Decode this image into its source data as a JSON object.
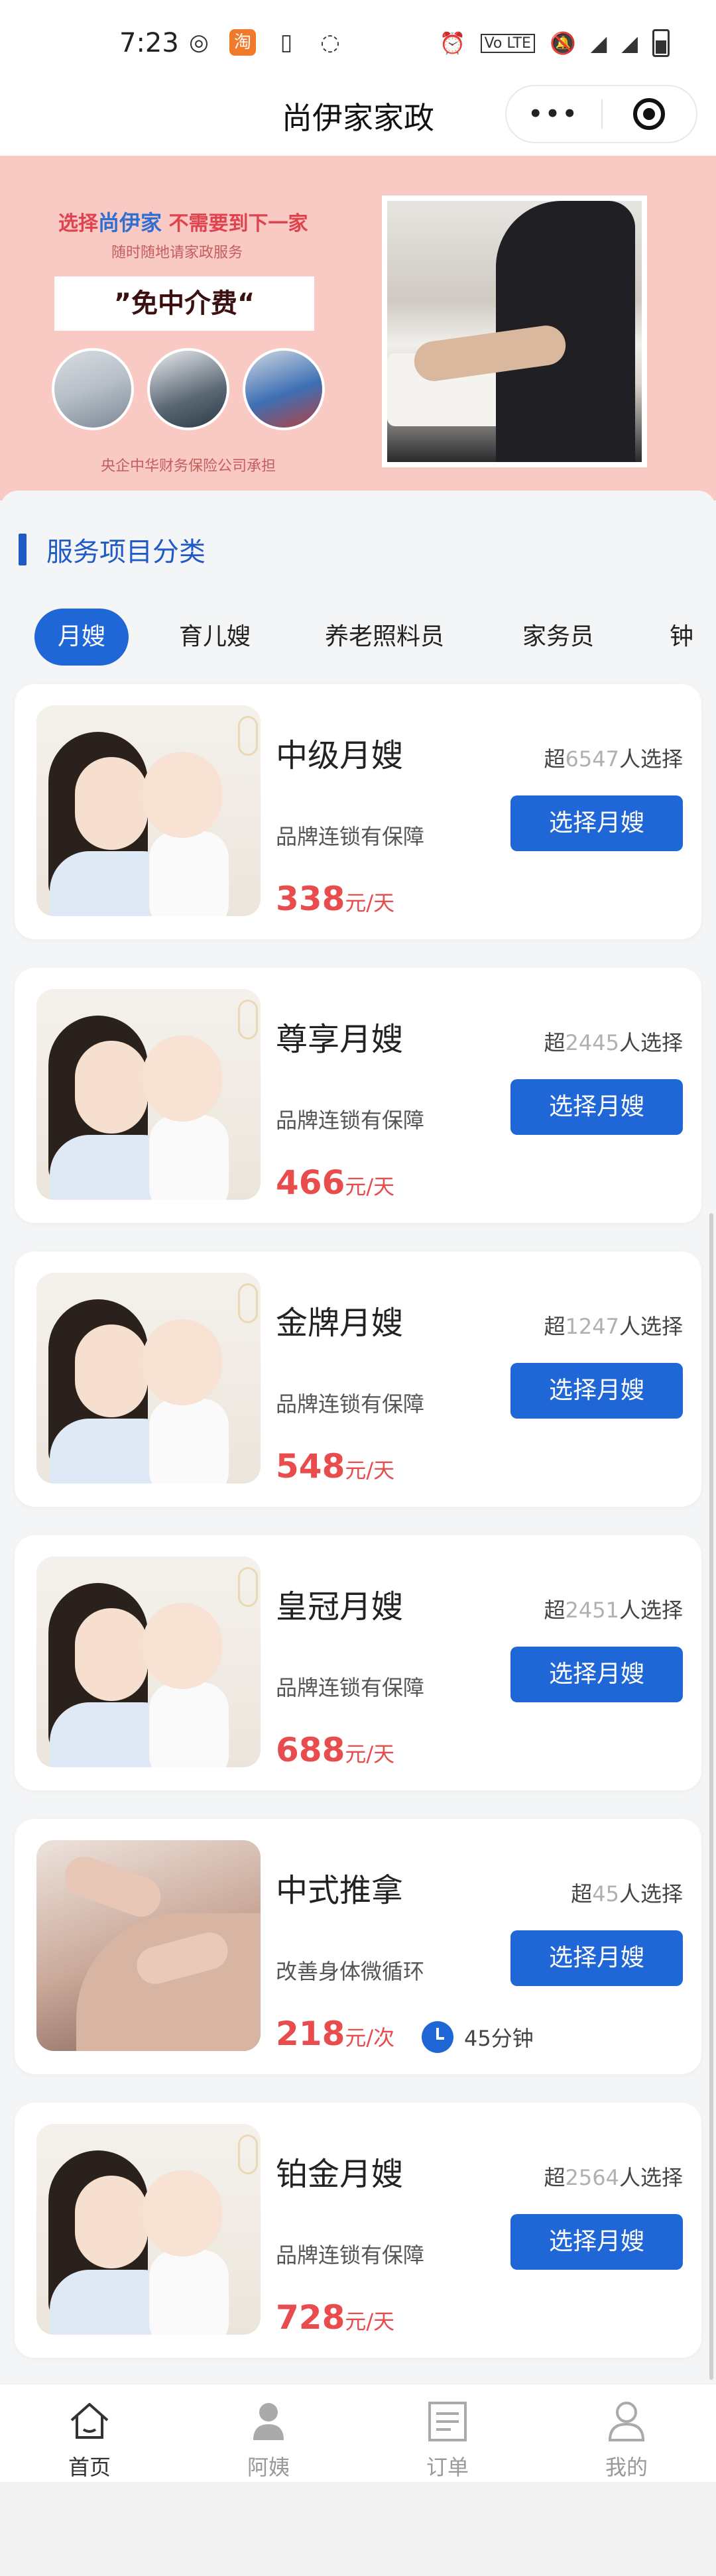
{
  "status_bar": {
    "time": "7:23",
    "left_icons": [
      "weibo-icon",
      "taobao-icon",
      "sim-icon",
      "chat-icon"
    ],
    "right_icons": [
      "alarm-icon",
      "volte-icon",
      "mute-icon",
      "signal-4g-icon",
      "signal-4g-icon",
      "battery-icon"
    ]
  },
  "title_bar": {
    "title": "尚伊家家政",
    "more_icon": "more-dots-icon",
    "target_icon": "target-icon"
  },
  "banner": {
    "line1_prefix": "选择",
    "line1_brand": "尚伊家",
    "line1_suffix": "不需要到下一家",
    "line2": "随时随地请家政服务",
    "slogan": "”免中介费“",
    "footer": "央企中华财务保险公司承担"
  },
  "section": {
    "title": "服务项目分类"
  },
  "tabs": [
    {
      "label": "月嫂",
      "active": true
    },
    {
      "label": "育儿嫂",
      "active": false
    },
    {
      "label": "养老照料员",
      "active": false
    },
    {
      "label": "家务员",
      "active": false
    },
    {
      "label": "钟",
      "active": false
    }
  ],
  "cards": [
    {
      "name": "中级月嫂",
      "popular_prefix": "超",
      "popular_count": "6547",
      "popular_suffix": "人选择",
      "desc": "品牌连锁有保障",
      "button": "选择月嫂",
      "price": "338",
      "unit": "元/天",
      "image": "mother-baby"
    },
    {
      "name": "尊享月嫂",
      "popular_prefix": "超",
      "popular_count": "2445",
      "popular_suffix": "人选择",
      "desc": "品牌连锁有保障",
      "button": "选择月嫂",
      "price": "466",
      "unit": "元/天",
      "image": "mother-baby"
    },
    {
      "name": "金牌月嫂",
      "popular_prefix": "超",
      "popular_count": "1247",
      "popular_suffix": "人选择",
      "desc": "品牌连锁有保障",
      "button": "选择月嫂",
      "price": "548",
      "unit": "元/天",
      "image": "mother-baby"
    },
    {
      "name": "皇冠月嫂",
      "popular_prefix": "超",
      "popular_count": "2451",
      "popular_suffix": "人选择",
      "desc": "品牌连锁有保障",
      "button": "选择月嫂",
      "price": "688",
      "unit": "元/天",
      "image": "mother-baby"
    },
    {
      "name": "中式推拿",
      "popular_prefix": "超",
      "popular_count": "45",
      "popular_suffix": "人选择",
      "desc": "改善身体微循环",
      "button": "选择月嫂",
      "price": "218",
      "unit": "元/次",
      "duration": "45分钟",
      "image": "massage"
    },
    {
      "name": "铂金月嫂",
      "popular_prefix": "超",
      "popular_count": "2564",
      "popular_suffix": "人选择",
      "desc": "品牌连锁有保障",
      "button": "选择月嫂",
      "price": "728",
      "unit": "元/天",
      "image": "mother-baby"
    }
  ],
  "bottom_nav": [
    {
      "label": "首页",
      "icon": "home-icon",
      "active": true
    },
    {
      "label": "阿姨",
      "icon": "nanny-icon",
      "active": false
    },
    {
      "label": "订单",
      "icon": "order-icon",
      "active": false
    },
    {
      "label": "我的",
      "icon": "profile-icon",
      "active": false
    }
  ],
  "colors": {
    "primary": "#1f66d6",
    "price": "#e84c4c",
    "banner_bg": "#f9c9c4"
  }
}
